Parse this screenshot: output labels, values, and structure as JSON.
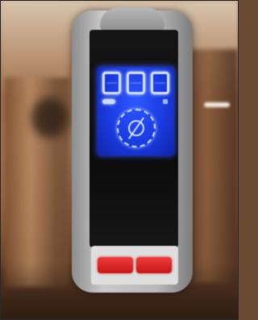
{
  "scene": {
    "subject": "handheld-device-with-blue-lcd",
    "lcd": {
      "digit_count": 3,
      "backlight_color": "#2a4cff",
      "segment_color": "#cfe0ff"
    },
    "buttons": {
      "count": 2,
      "color": "#e02a2a"
    },
    "background_colors": [
      "#c7a889",
      "#8b6244",
      "#4b2f1f"
    ],
    "device_body_color": "#b9b9b9",
    "icons": [
      "dial-icon"
    ]
  }
}
